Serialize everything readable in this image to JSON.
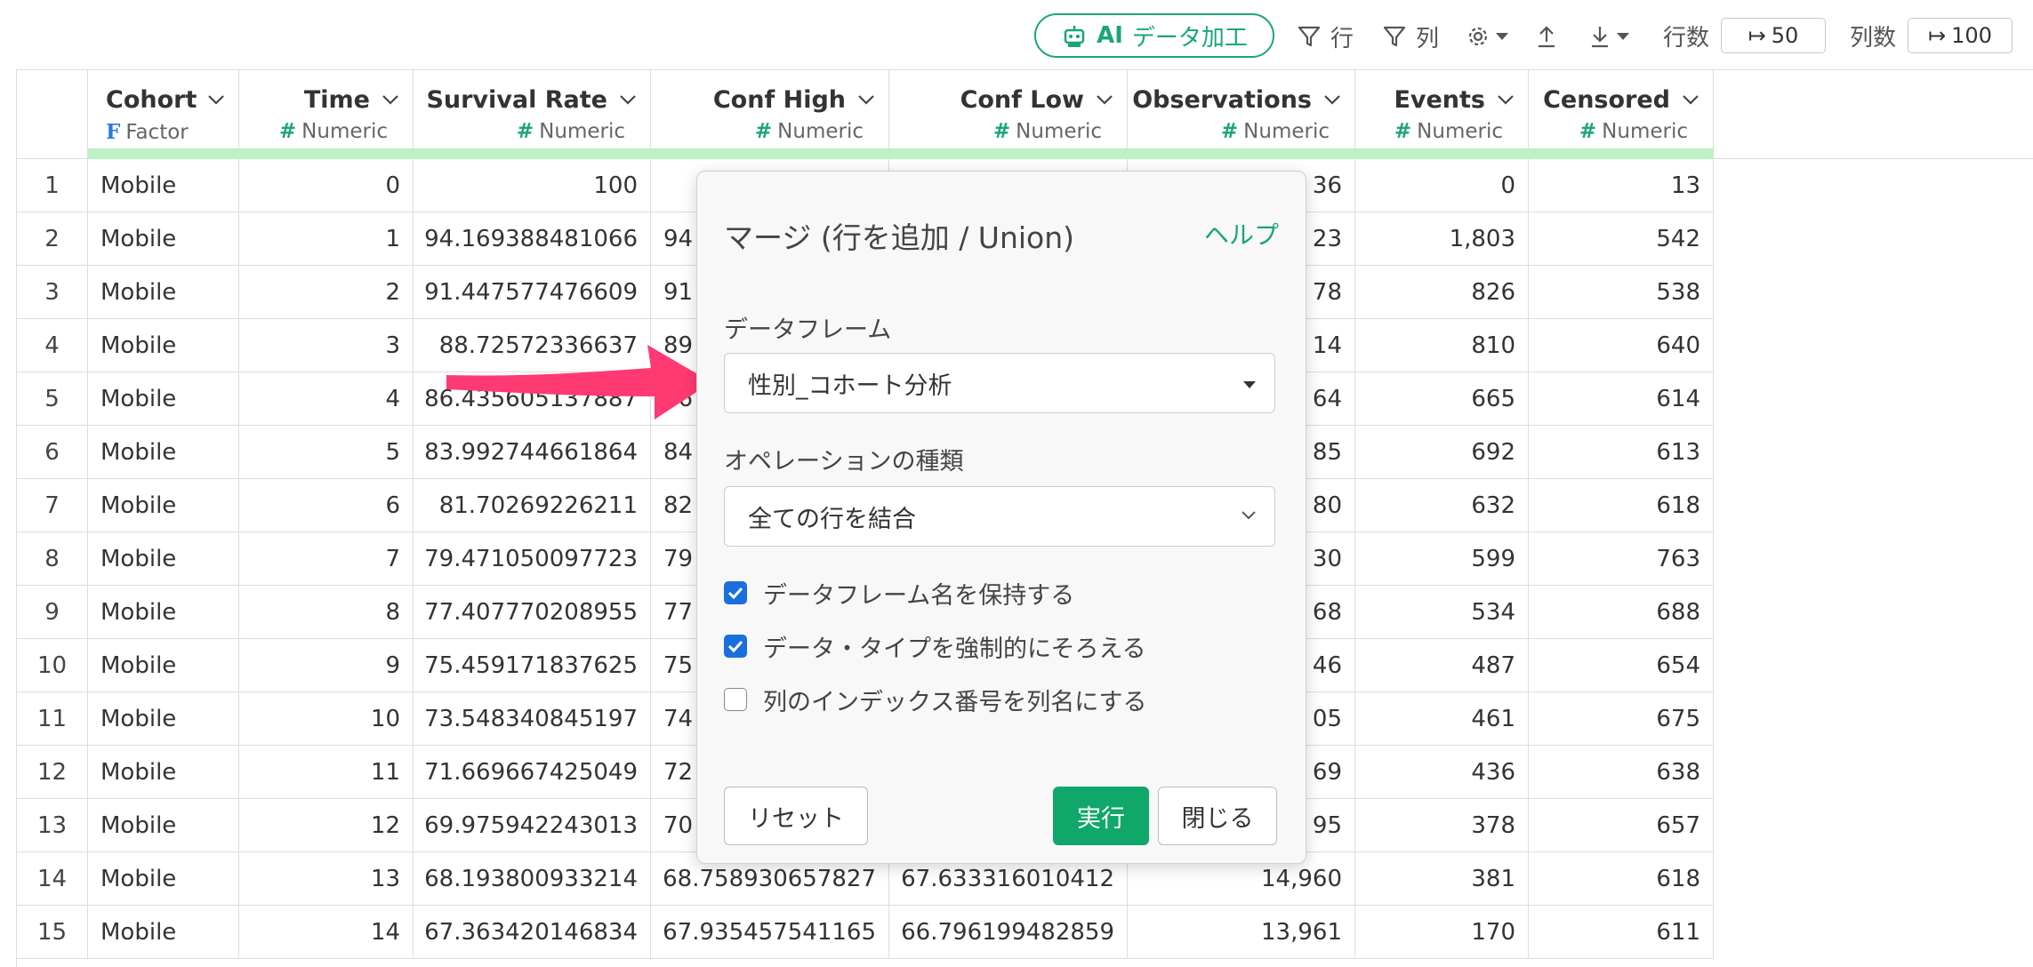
{
  "toolbar": {
    "ai_prefix": "AI",
    "ai_label": "データ加工",
    "row_filter": "行",
    "col_filter": "列",
    "rows_label": "行数",
    "rows_value": "50",
    "cols_label": "列数",
    "cols_value": "100",
    "accent": "#1aa675"
  },
  "table": {
    "columns": [
      {
        "name": "Cohort",
        "type": "Factor",
        "icon": "F"
      },
      {
        "name": "Time",
        "type": "Numeric",
        "icon": "#"
      },
      {
        "name": "Survival Rate",
        "type": "Numeric",
        "icon": "#"
      },
      {
        "name": "Conf High",
        "type": "Numeric",
        "icon": "#"
      },
      {
        "name": "Conf Low",
        "type": "Numeric",
        "icon": "#"
      },
      {
        "name": "Observations",
        "type": "Numeric",
        "icon": "#"
      },
      {
        "name": "Events",
        "type": "Numeric",
        "icon": "#"
      },
      {
        "name": "Censored",
        "type": "Numeric",
        "icon": "#"
      }
    ],
    "rows": [
      [
        "1",
        "Mobile",
        "0",
        "100",
        "",
        "36",
        "0",
        "13"
      ],
      [
        "2",
        "Mobile",
        "1",
        "94.169388481066",
        "94",
        "23",
        "1,803",
        "542"
      ],
      [
        "3",
        "Mobile",
        "2",
        "91.447577476609",
        "91",
        "78",
        "826",
        "538"
      ],
      [
        "4",
        "Mobile",
        "3",
        "88.72572336637",
        "89",
        "14",
        "810",
        "640"
      ],
      [
        "5",
        "Mobile",
        "4",
        "86.435605137887",
        "86",
        "64",
        "665",
        "614"
      ],
      [
        "6",
        "Mobile",
        "5",
        "83.992744661864",
        "84",
        "85",
        "692",
        "613"
      ],
      [
        "7",
        "Mobile",
        "6",
        "81.70269226211",
        "82",
        "80",
        "632",
        "618"
      ],
      [
        "8",
        "Mobile",
        "7",
        "79.471050097723",
        "79",
        "30",
        "599",
        "763"
      ],
      [
        "9",
        "Mobile",
        "8",
        "77.407770208955",
        "77",
        "68",
        "534",
        "688"
      ],
      [
        "10",
        "Mobile",
        "9",
        "75.459171837625",
        "75",
        "46",
        "487",
        "654"
      ],
      [
        "11",
        "Mobile",
        "10",
        "73.548340845197",
        "74",
        "05",
        "461",
        "675"
      ],
      [
        "12",
        "Mobile",
        "11",
        "71.669667425049",
        "72",
        "69",
        "436",
        "638"
      ],
      [
        "13",
        "Mobile",
        "12",
        "69.975942243013",
        "70",
        "95",
        "378",
        "657"
      ],
      [
        "14",
        "Mobile",
        "13",
        "68.193800933214",
        "68.758930657827",
        "67.633316010412",
        "14,960",
        "381",
        "618"
      ],
      [
        "15",
        "Mobile",
        "14",
        "67.363420146834",
        "67.935457541165",
        "66.796199482859",
        "13,961",
        "170",
        "611"
      ]
    ]
  },
  "dialog": {
    "title": "マージ (行を追加 / Union)",
    "help": "ヘルプ",
    "dataframe_label": "データフレーム",
    "dataframe_value": "性別_コホート分析",
    "operation_label": "オペレーションの種類",
    "operation_value": "全ての行を結合",
    "checkboxes": [
      {
        "label": "データフレーム名を保持する",
        "checked": true
      },
      {
        "label": "データ・タイプを強制的にそろえる",
        "checked": true
      },
      {
        "label": "列のインデックス番号を列名にする",
        "checked": false
      }
    ],
    "reset": "リセット",
    "run": "実行",
    "close": "閉じる"
  }
}
